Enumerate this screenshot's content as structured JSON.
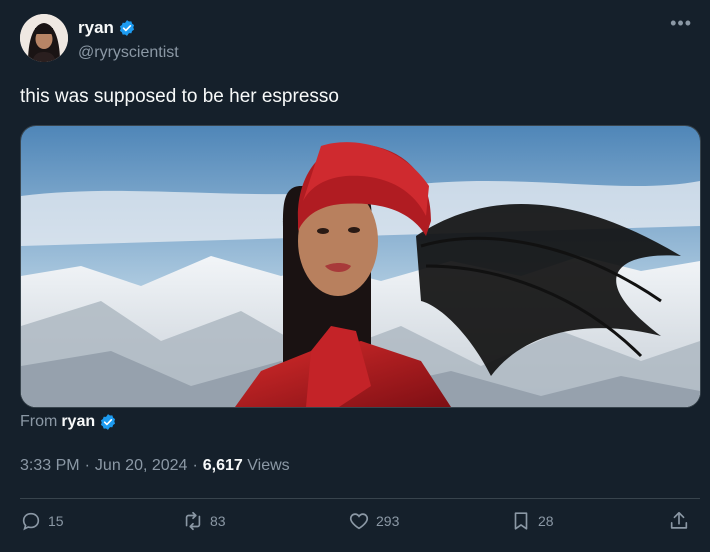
{
  "tweet": {
    "author_name": "ryan",
    "author_handle": "@ryryscientist",
    "text": "this was supposed to be her espresso",
    "from_label": "From",
    "from_name": "ryan",
    "time": "3:33 PM",
    "date": "Jun 20, 2024",
    "views_count": "6,617",
    "views_label": "Views",
    "sep": "·"
  },
  "actions": {
    "replies": "15",
    "retweets": "83",
    "likes": "293",
    "bookmarks": "28"
  },
  "icons": [
    "verified-badge-icon",
    "more-icon",
    "reply-icon",
    "retweet-icon",
    "like-icon",
    "bookmark-icon",
    "share-icon"
  ],
  "colors": {
    "background": "#15202b",
    "verified": "#1d9bf0",
    "secondary_text": "#8b98a5"
  }
}
